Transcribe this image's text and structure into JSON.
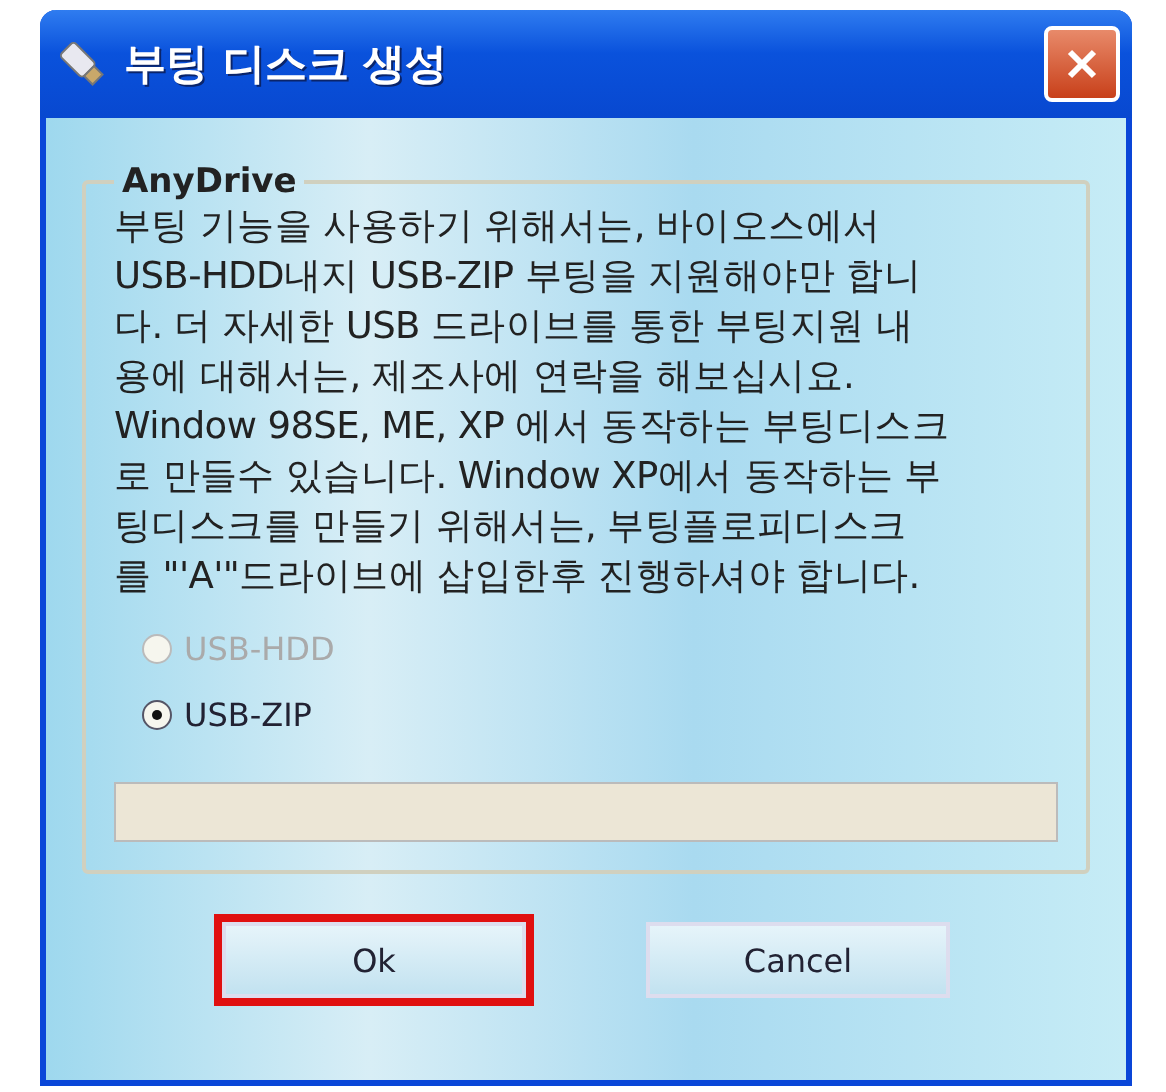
{
  "window": {
    "title": "부팅 디스크 생성"
  },
  "group": {
    "title": "AnyDrive",
    "description_lines": [
      "부팅 기능을 사용하기 위해서는, 바이오스에서",
      "USB-HDD내지 USB-ZIP 부팅을 지원해야만 합니",
      "다. 더 자세한 USB 드라이브를 통한 부팅지원 내",
      "용에 대해서는, 제조사에 연락을 해보십시요.",
      "Window 98SE, ME, XP 에서 동작하는 부팅디스크",
      "로 만들수 있습니다. Window XP에서 동작하는 부",
      "팅디스크를 만들기 위해서는, 부팅플로피디스크",
      "를 \"'A'\"드라이브에 삽입한후 진행하셔야 합니다."
    ],
    "options": [
      {
        "label": "USB-HDD",
        "selected": false,
        "disabled": true
      },
      {
        "label": "USB-ZIP",
        "selected": true,
        "disabled": false
      }
    ],
    "progress": {
      "level": 0
    }
  },
  "buttons": [
    {
      "label": "Ok",
      "highlighted": true
    },
    {
      "label": "Cancel",
      "highlighted": false
    }
  ]
}
